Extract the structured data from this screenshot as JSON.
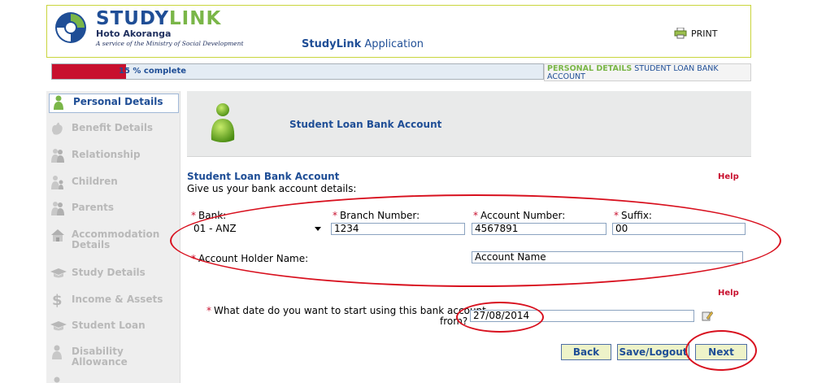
{
  "header": {
    "brand_study": "STUDY",
    "brand_link": "LINK",
    "brand_subtitle": "Hoto Akoranga",
    "brand_tagline": "A service of the Ministry of Social Development",
    "app_title_bold": "StudyLink",
    "app_title_rest": "Application",
    "print_label": "PRINT"
  },
  "progress": {
    "label": "15 % complete",
    "value": 15
  },
  "breadcrumb": {
    "current": "PERSONAL DETAILS",
    "page": "STUDENT LOAN BANK ACCOUNT"
  },
  "sidebar": {
    "items": [
      {
        "label": "Personal Details",
        "icon": "person-green-icon",
        "active": true
      },
      {
        "label": "Benefit Details",
        "icon": "hand-icon",
        "active": false
      },
      {
        "label": "Relationship",
        "icon": "couple-icon",
        "active": false
      },
      {
        "label": "Children",
        "icon": "children-icon",
        "active": false
      },
      {
        "label": "Parents",
        "icon": "parents-icon",
        "active": false
      },
      {
        "label": "Accommodation Details",
        "icon": "house-icon",
        "active": false
      },
      {
        "label": "Study Details",
        "icon": "grad-cap-icon",
        "active": false
      },
      {
        "label": "Income & Assets",
        "icon": "dollar-icon",
        "active": false
      },
      {
        "label": "Student Loan",
        "icon": "grad-cap-icon",
        "active": false
      },
      {
        "label": "Disability Allowance",
        "icon": "person-icon",
        "active": false
      }
    ]
  },
  "panel": {
    "title": "Student Loan Bank Account"
  },
  "section": {
    "title": "Student Loan Bank Account",
    "description": "Give us your bank account details:",
    "help": "Help",
    "help2": "Help"
  },
  "form": {
    "bank_label": "Bank:",
    "bank_value": "01 - ANZ",
    "branch_label": "Branch Number:",
    "branch_value": "1234",
    "account_label": "Account Number:",
    "account_value": "4567891",
    "suffix_label": "Suffix:",
    "suffix_value": "00",
    "holder_label": "Account Holder Name:",
    "holder_value": "Account Name",
    "date_label_line1": "What date do you want to start using this bank account",
    "date_label_line2": "from?",
    "date_value": "27/08/2014"
  },
  "buttons": {
    "back": "Back",
    "save_logout": "Save/Logout",
    "next": "Next"
  },
  "colors": {
    "brand_blue": "#1f4e96",
    "brand_green": "#7ab648",
    "required_red": "#c8102e",
    "button_bg": "#eef3c9",
    "annotation_red": "#d8101e"
  }
}
